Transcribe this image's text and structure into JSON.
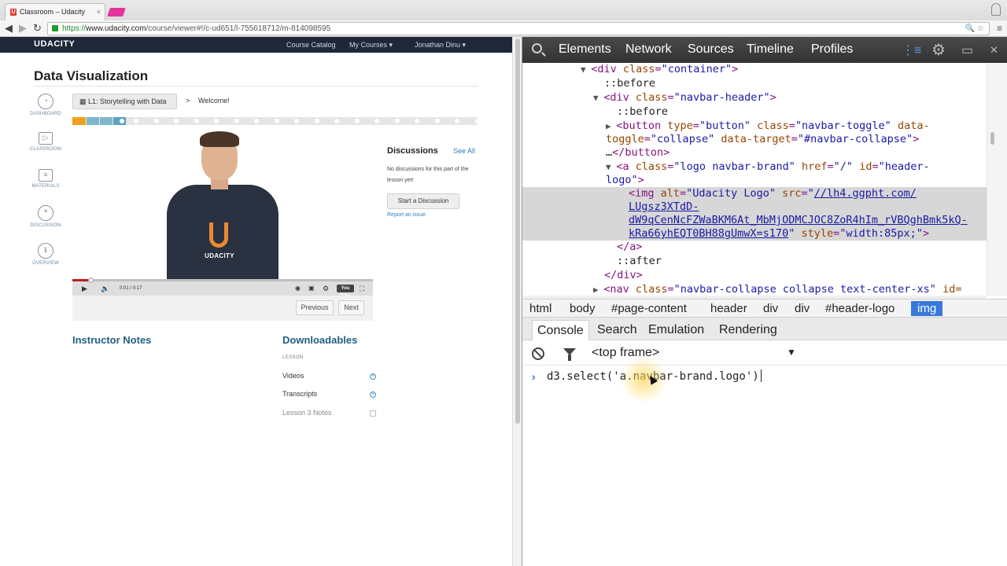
{
  "browser": {
    "tab_title": "Classroom – Udacity",
    "tab_favicon": "U",
    "tab_close": "×",
    "url_scheme": "https://",
    "url_host": "www.udacity.com",
    "url_path": "/course/viewer#!/c-ud651/l-755618712/m-814098595",
    "nav_back": "◀",
    "nav_forward": "▶",
    "nav_reload": "↻",
    "omni_icons": "🔍 ☆",
    "menu": "≡"
  },
  "udacity": {
    "logo": "UDACITY",
    "nav_links": [
      "Course Catalog",
      "My Courses ▾",
      "Jonathan Dinu ▾"
    ],
    "course_title": "Data Visualization",
    "sidenav": [
      {
        "icon": "dashboard-icon",
        "glyph": "◔",
        "label": "DASHBOARD"
      },
      {
        "icon": "classroom-icon",
        "glyph": "▷",
        "label": "CLASSROOM"
      },
      {
        "icon": "materials-icon",
        "glyph": "≡",
        "label": "MATERIALS"
      },
      {
        "icon": "discussion-icon",
        "glyph": "❝",
        "label": "DISCUSSION"
      },
      {
        "icon": "overview-icon",
        "glyph": "ℹ",
        "label": "OVERVIEW"
      }
    ],
    "lesson_pill": "▦  L1: Storytelling with Data",
    "breadcrumb_sep": ">",
    "breadcrumb_current": "Welcome!",
    "progress": {
      "orange": "#f0a020",
      "teal": "#7fb6cc",
      "current": "#5aa3c1"
    },
    "video": {
      "shirt_text": "UDACITY",
      "time": "0:01 / 0:17",
      "progress_fraction": 0.06,
      "play": "▶",
      "volume": "🔈",
      "yt": "You Tube",
      "right_controls": [
        "◉",
        "▣",
        "⚙"
      ],
      "fullscreen": "⛶"
    },
    "buttons": {
      "previous": "Previous",
      "next": "Next"
    },
    "discussions": {
      "title": "Discussions",
      "see_all": "See All",
      "body": "No discussions for this part of the lesson yet!",
      "start": "Start a Discussion",
      "report": "Report an issue"
    },
    "instructor_notes": "Instructor Notes",
    "downloadables": {
      "title": "Downloadables",
      "section": "LESSON",
      "items": [
        "Videos",
        "Transcripts",
        "Lesson 3 Notes"
      ]
    }
  },
  "devtools": {
    "tabs": [
      "Elements",
      "Network",
      "Sources",
      "Timeline",
      "Profiles"
    ],
    "tools": [
      "⋮≡",
      "⚙",
      "▭",
      "✕"
    ],
    "elements_lines": [
      {
        "text_tag": "▼ <div ",
        "text_attr": "class",
        "text_val": "\"container\"",
        "text_end": ">"
      },
      {
        "text_plain": "::before"
      },
      {
        "text_tag": "▼ <div ",
        "text_attr": "class",
        "text_val": "\"navbar-header\"",
        "text_end": ">"
      },
      {
        "text_plain": "::before"
      }
    ],
    "el_button_1": "▶ <button ",
    "el_button_attrs": "type=\"button\" class=\"navbar-toggle\" data-",
    "el_button_2": "toggle=\"collapse\" data-target=\"#navbar-collapse\">",
    "el_button_3": "…</button>",
    "el_a_1": "▼ <a class=\"logo navbar-brand\" href=\"/\" id=\"header-",
    "el_a_2": "logo\">",
    "el_img_1": "<img alt=\"Udacity Logo\" src=\"",
    "el_img_link1": "//lh4.ggpht.com/",
    "el_img_link2": "LUgsz3XTdD-",
    "el_img_link3": "dW9qCenNcFZWaBKM6At_MbMjODMCJOC8ZoR4hIm_rVBQghBmk5kQ-",
    "el_img_link4": "kRa66yhEQT0BH88gUmwX=s170",
    "el_img_tail": "\" style=\"width:85px;\">",
    "el_a_close": "</a>",
    "el_after": "::after",
    "el_div_close": "</div>",
    "el_nav": "▶ <nav class=\"navbar-collapse collapse text-center-xs\" id=",
    "crumbs": [
      "html",
      "body",
      "#page-content",
      "header",
      "div",
      "div",
      "#header-logo",
      "img"
    ],
    "drawer_tabs": [
      "Console",
      "Search",
      "Emulation",
      "Rendering"
    ],
    "frame": "<top frame>",
    "frame_arrow": "▼",
    "prompt": "›",
    "command": "d3.select('a.navbar-brand.logo')"
  }
}
